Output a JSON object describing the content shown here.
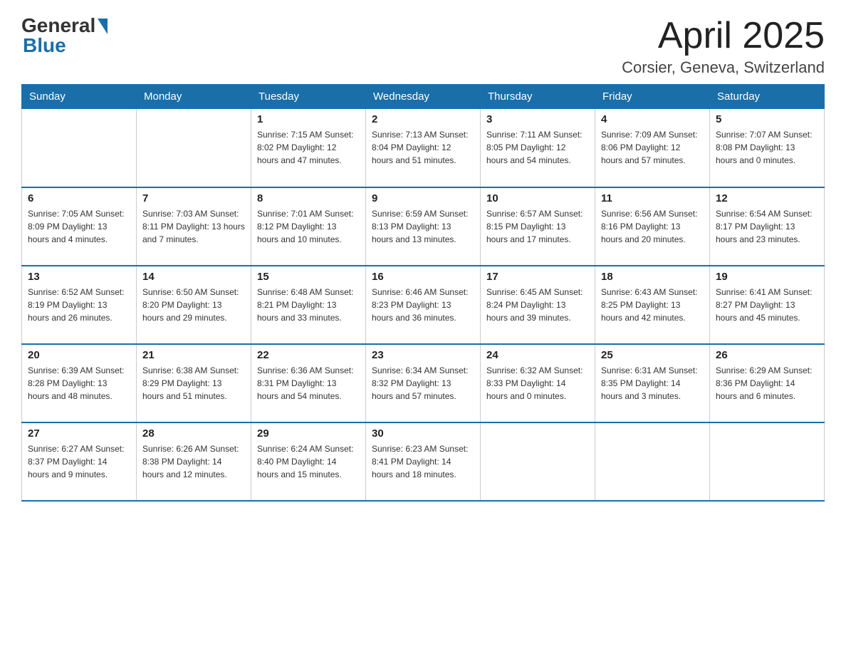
{
  "header": {
    "logo_general": "General",
    "logo_blue": "Blue",
    "month_title": "April 2025",
    "location": "Corsier, Geneva, Switzerland"
  },
  "calendar": {
    "days_of_week": [
      "Sunday",
      "Monday",
      "Tuesday",
      "Wednesday",
      "Thursday",
      "Friday",
      "Saturday"
    ],
    "weeks": [
      [
        {
          "day": "",
          "info": ""
        },
        {
          "day": "",
          "info": ""
        },
        {
          "day": "1",
          "info": "Sunrise: 7:15 AM\nSunset: 8:02 PM\nDaylight: 12 hours\nand 47 minutes."
        },
        {
          "day": "2",
          "info": "Sunrise: 7:13 AM\nSunset: 8:04 PM\nDaylight: 12 hours\nand 51 minutes."
        },
        {
          "day": "3",
          "info": "Sunrise: 7:11 AM\nSunset: 8:05 PM\nDaylight: 12 hours\nand 54 minutes."
        },
        {
          "day": "4",
          "info": "Sunrise: 7:09 AM\nSunset: 8:06 PM\nDaylight: 12 hours\nand 57 minutes."
        },
        {
          "day": "5",
          "info": "Sunrise: 7:07 AM\nSunset: 8:08 PM\nDaylight: 13 hours\nand 0 minutes."
        }
      ],
      [
        {
          "day": "6",
          "info": "Sunrise: 7:05 AM\nSunset: 8:09 PM\nDaylight: 13 hours\nand 4 minutes."
        },
        {
          "day": "7",
          "info": "Sunrise: 7:03 AM\nSunset: 8:11 PM\nDaylight: 13 hours\nand 7 minutes."
        },
        {
          "day": "8",
          "info": "Sunrise: 7:01 AM\nSunset: 8:12 PM\nDaylight: 13 hours\nand 10 minutes."
        },
        {
          "day": "9",
          "info": "Sunrise: 6:59 AM\nSunset: 8:13 PM\nDaylight: 13 hours\nand 13 minutes."
        },
        {
          "day": "10",
          "info": "Sunrise: 6:57 AM\nSunset: 8:15 PM\nDaylight: 13 hours\nand 17 minutes."
        },
        {
          "day": "11",
          "info": "Sunrise: 6:56 AM\nSunset: 8:16 PM\nDaylight: 13 hours\nand 20 minutes."
        },
        {
          "day": "12",
          "info": "Sunrise: 6:54 AM\nSunset: 8:17 PM\nDaylight: 13 hours\nand 23 minutes."
        }
      ],
      [
        {
          "day": "13",
          "info": "Sunrise: 6:52 AM\nSunset: 8:19 PM\nDaylight: 13 hours\nand 26 minutes."
        },
        {
          "day": "14",
          "info": "Sunrise: 6:50 AM\nSunset: 8:20 PM\nDaylight: 13 hours\nand 29 minutes."
        },
        {
          "day": "15",
          "info": "Sunrise: 6:48 AM\nSunset: 8:21 PM\nDaylight: 13 hours\nand 33 minutes."
        },
        {
          "day": "16",
          "info": "Sunrise: 6:46 AM\nSunset: 8:23 PM\nDaylight: 13 hours\nand 36 minutes."
        },
        {
          "day": "17",
          "info": "Sunrise: 6:45 AM\nSunset: 8:24 PM\nDaylight: 13 hours\nand 39 minutes."
        },
        {
          "day": "18",
          "info": "Sunrise: 6:43 AM\nSunset: 8:25 PM\nDaylight: 13 hours\nand 42 minutes."
        },
        {
          "day": "19",
          "info": "Sunrise: 6:41 AM\nSunset: 8:27 PM\nDaylight: 13 hours\nand 45 minutes."
        }
      ],
      [
        {
          "day": "20",
          "info": "Sunrise: 6:39 AM\nSunset: 8:28 PM\nDaylight: 13 hours\nand 48 minutes."
        },
        {
          "day": "21",
          "info": "Sunrise: 6:38 AM\nSunset: 8:29 PM\nDaylight: 13 hours\nand 51 minutes."
        },
        {
          "day": "22",
          "info": "Sunrise: 6:36 AM\nSunset: 8:31 PM\nDaylight: 13 hours\nand 54 minutes."
        },
        {
          "day": "23",
          "info": "Sunrise: 6:34 AM\nSunset: 8:32 PM\nDaylight: 13 hours\nand 57 minutes."
        },
        {
          "day": "24",
          "info": "Sunrise: 6:32 AM\nSunset: 8:33 PM\nDaylight: 14 hours\nand 0 minutes."
        },
        {
          "day": "25",
          "info": "Sunrise: 6:31 AM\nSunset: 8:35 PM\nDaylight: 14 hours\nand 3 minutes."
        },
        {
          "day": "26",
          "info": "Sunrise: 6:29 AM\nSunset: 8:36 PM\nDaylight: 14 hours\nand 6 minutes."
        }
      ],
      [
        {
          "day": "27",
          "info": "Sunrise: 6:27 AM\nSunset: 8:37 PM\nDaylight: 14 hours\nand 9 minutes."
        },
        {
          "day": "28",
          "info": "Sunrise: 6:26 AM\nSunset: 8:38 PM\nDaylight: 14 hours\nand 12 minutes."
        },
        {
          "day": "29",
          "info": "Sunrise: 6:24 AM\nSunset: 8:40 PM\nDaylight: 14 hours\nand 15 minutes."
        },
        {
          "day": "30",
          "info": "Sunrise: 6:23 AM\nSunset: 8:41 PM\nDaylight: 14 hours\nand 18 minutes."
        },
        {
          "day": "",
          "info": ""
        },
        {
          "day": "",
          "info": ""
        },
        {
          "day": "",
          "info": ""
        }
      ]
    ]
  }
}
